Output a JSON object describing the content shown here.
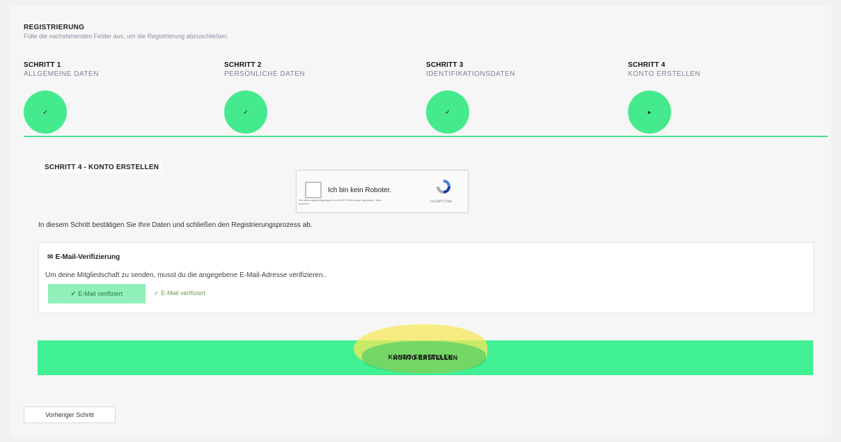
{
  "header": {
    "title": "REGISTRIERUNG",
    "subtitle": "Fülle die nachstehenden Felder aus, um die Registrierung abzuschließen."
  },
  "steps": [
    {
      "number": "SCHRITT 1",
      "name": "ALLGEMEINE DATEN",
      "marker": "✓"
    },
    {
      "number": "SCHRITT 2",
      "name": "PERSÖNLICHE DATEN",
      "marker": "✓"
    },
    {
      "number": "SCHRITT 3",
      "name": "IDENTIFIKATIONSDATEN",
      "marker": "✓"
    },
    {
      "number": "SCHRITT 4",
      "name": "KONTO ERSTELLEN",
      "marker": "▸"
    }
  ],
  "section_title": "SCHRITT 4 - KONTO ERSTELLEN",
  "captcha": {
    "label": "Ich bin kein Roboter.",
    "brand": "reCAPTCHA",
    "fine_print": "Die Nutzungsbedingungen für reCAPTCHA wurden geändert. Jetzt ansehen",
    "icon": "recaptcha-icon"
  },
  "intro_text": "In diesem Schritt bestätigen Sie Ihre Daten und schließen den Registrierungsprozess ab.",
  "email_verification": {
    "title": "E-Mail-Verifizierung",
    "title_icon": "envelope-icon",
    "text": "Um deine Mitgliedschaft zu senden, musst du die angegebene E-Mail-Adresse verifizieren..",
    "button_label": "E-Mail verifiziert",
    "status_label": "E-Mail verifiziert"
  },
  "create_button": "KONTO ERSTELLEN",
  "prev_button": "Vorheriger Schritt",
  "colors": {
    "accent": "#42f094",
    "verified_bg": "#8ff0b9",
    "status_green": "#6fa14a",
    "highlight": "#f6e85a"
  }
}
